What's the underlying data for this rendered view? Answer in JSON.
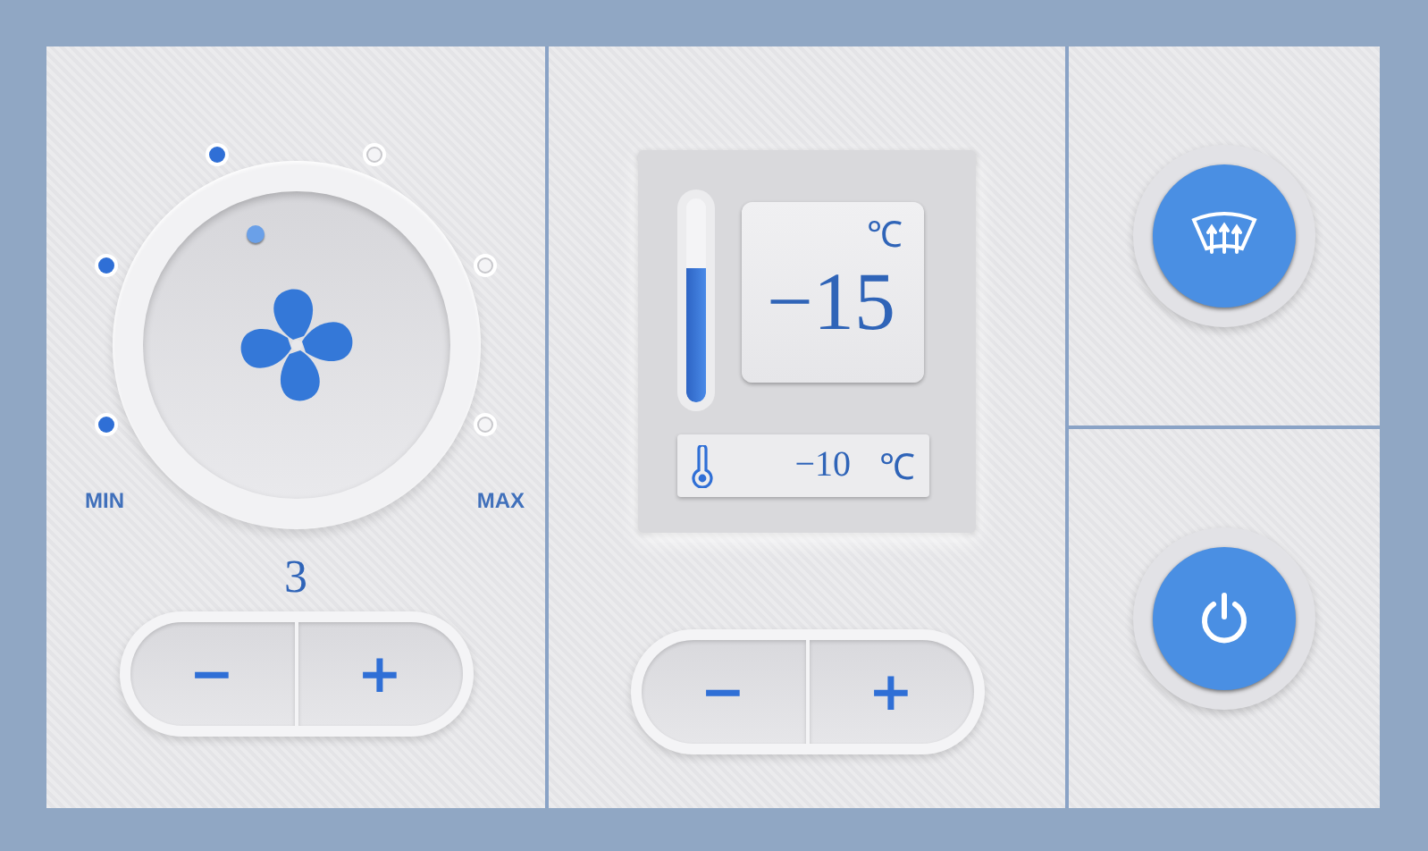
{
  "fan": {
    "speed_dots": [
      {
        "on": true
      },
      {
        "on": true
      },
      {
        "on": true
      },
      {
        "on": false
      },
      {
        "on": false
      },
      {
        "on": false
      }
    ],
    "min_label": "MIN",
    "max_label": "MAX",
    "speed": "3",
    "buttons": [
      "−",
      "+"
    ]
  },
  "temperature": {
    "unit": "℃",
    "setpoint": "−15",
    "level": 0.66,
    "outside": "−10",
    "outside_unit": "℃",
    "buttons": [
      "−",
      "+"
    ]
  },
  "controls": [
    {
      "kind": "defrost",
      "on": true
    },
    {
      "kind": "power",
      "on": true
    }
  ]
}
